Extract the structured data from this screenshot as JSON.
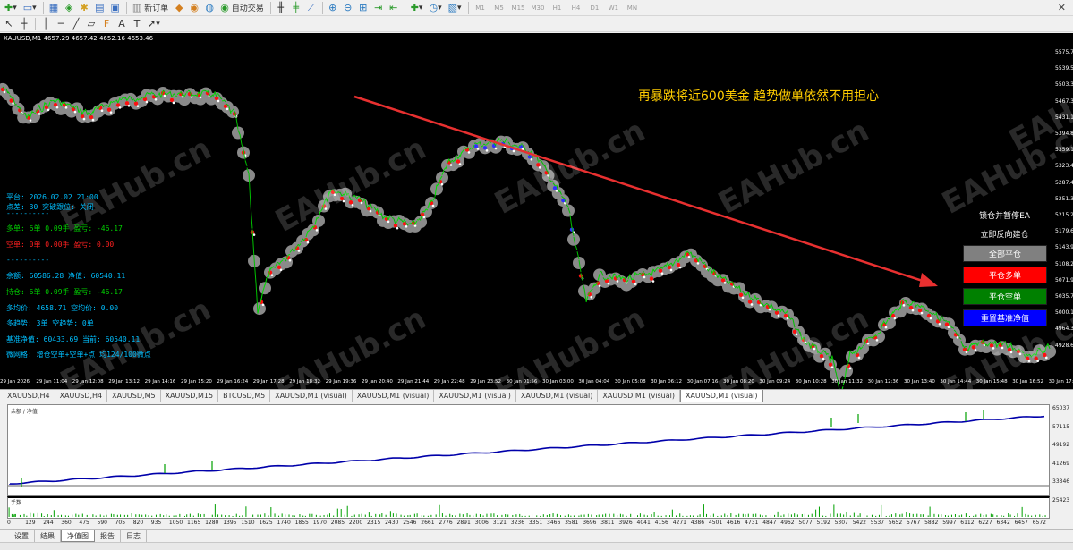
{
  "toolbar": {
    "new_order": "新订单",
    "autotrade": "自动交易",
    "timeframes": [
      "M1",
      "M5",
      "M15",
      "M30",
      "H1",
      "H4",
      "D1",
      "W1",
      "MN"
    ]
  },
  "chart": {
    "title": "XAUUSD,M1  4657.29 4657.42 4652.16 4653.46",
    "annotation": "再暴跌将近600美金  趋势做单依然不用担心",
    "watermark": "EAHub.cn",
    "y_ticks": [
      "5575.70",
      "5539.50",
      "5503.30",
      "5467.30",
      "5431.10",
      "5394.85",
      "5359.10",
      "5323.45",
      "5287.45",
      "5251.30",
      "5215.25",
      "5179.60",
      "5143.90",
      "5108.20",
      "5071.95",
      "5035.75",
      "5000.10",
      "4964.35",
      "4928.65"
    ],
    "x_ticks": [
      "29 Jan 2026",
      "29 Jan 11:04",
      "29 Jan 12:08",
      "29 Jan 13:12",
      "29 Jan 14:16",
      "29 Jan 15:20",
      "29 Jan 16:24",
      "29 Jan 17:28",
      "29 Jan 18:32",
      "29 Jan 19:36",
      "29 Jan 20:40",
      "29 Jan 21:44",
      "29 Jan 22:48",
      "29 Jan 23:52",
      "30 Jan 01:56",
      "30 Jan 03:00",
      "30 Jan 04:04",
      "30 Jan 05:08",
      "30 Jan 06:12",
      "30 Jan 07:16",
      "30 Jan 08:20",
      "30 Jan 09:24",
      "30 Jan 10:28",
      "30 Jan 11:32",
      "30 Jan 12:36",
      "30 Jan 13:40",
      "30 Jan 14:44",
      "30 Jan 15:48",
      "30 Jan 16:52",
      "30 Jan 17:56"
    ],
    "colors": {
      "up": "#00e000",
      "down": "#e00000",
      "annotation": "#ffcc00",
      "arrow": "#e83030"
    }
  },
  "info_panel": {
    "lines": [
      {
        "text": "点差: 30  突破跟位: 关闭",
        "color": "#00bfff"
      },
      {
        "text": "平台: 2026.02.02 21:00",
        "color": "#00bfff"
      },
      {
        "text": "----------",
        "color": "#00bfff"
      },
      {
        "text": "多单: 6单  0.09手  盈亏: -46.17",
        "color": "#00d000"
      },
      {
        "text": "空单: 0单  0.00手  盈亏: 0.00",
        "color": "#ff2020"
      },
      {
        "text": "----------",
        "color": "#00bfff"
      },
      {
        "text": "余额: 60586.28  净值: 60540.11",
        "color": "#00bfff"
      },
      {
        "text": "持仓: 6单  0.09手  盈亏: -46.17",
        "color": "#00d000"
      },
      {
        "text": "多均价: 4658.71  空均价: 0.00",
        "color": "#00bfff"
      },
      {
        "text": "多趋势: 3单  空趋势: 0单",
        "color": "#00bfff"
      },
      {
        "text": "基准净值: 60433.69  当前: 60540.11",
        "color": "#00bfff"
      },
      {
        "text": "微网格: 增仓空单+空单+点 均124/100微点",
        "color": "#00bfff"
      }
    ]
  },
  "ea_controls": {
    "label1": "锁仓并暂停EA",
    "label2": "立即反向建仓",
    "btn_close_all": "全部平仓",
    "btn_close_long": "平仓多单",
    "btn_close_short": "平仓空单",
    "btn_reset": "重置基准净值",
    "colors": {
      "close_all": "#808080",
      "close_long": "#ff0000",
      "close_short": "#008000",
      "reset": "#0000ff"
    }
  },
  "chart_tabs": [
    "XAUUSD,H4",
    "XAUUSD,H4",
    "XAUUSD,M5",
    "XAUUSD,M15",
    "BTCUSD,M5",
    "XAUUSD,M1 (visual)",
    "XAUUSD,M1 (visual)",
    "XAUUSD,M1 (visual)",
    "XAUUSD,M1 (visual)",
    "XAUUSD,M1 (visual)",
    "XAUUSD,M1 (visual)"
  ],
  "active_chart_tab": 10,
  "tester": {
    "legend": "余额 / 净值",
    "y_ticks": [
      "65037",
      "57115",
      "49192",
      "41269",
      "33346",
      "25423"
    ],
    "x_ticks": [
      "0",
      "129",
      "244",
      "360",
      "475",
      "590",
      "705",
      "820",
      "935",
      "1050",
      "1165",
      "1280",
      "1395",
      "1510",
      "1625",
      "1740",
      "1855",
      "1970",
      "2085",
      "2200",
      "2315",
      "2430",
      "2546",
      "2661",
      "2776",
      "2891",
      "3006",
      "3121",
      "3236",
      "3351",
      "3466",
      "3581",
      "3696",
      "3811",
      "3926",
      "4041",
      "4156",
      "4271",
      "4386",
      "4501",
      "4616",
      "4731",
      "4847",
      "4962",
      "5077",
      "5192",
      "5307",
      "5422",
      "5537",
      "5652",
      "5767",
      "5882",
      "5997",
      "6112",
      "6227",
      "6342",
      "6457",
      "6572"
    ],
    "margin_label": "手数"
  },
  "bottom_tabs": [
    "设置",
    "结果",
    "净值图",
    "报告",
    "日志"
  ],
  "active_bottom_tab": 2
}
